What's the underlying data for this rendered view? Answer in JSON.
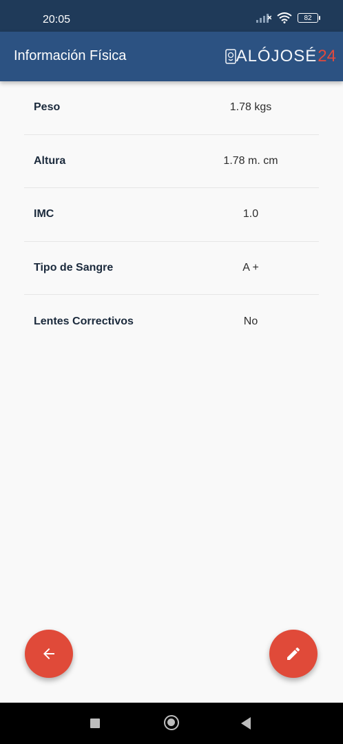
{
  "status_bar": {
    "time": "20:05",
    "battery": "82"
  },
  "app_bar": {
    "title": "Información Física",
    "logo_text": "ALÓJOSÉ",
    "logo_num": "24"
  },
  "info_rows": [
    {
      "label": "Peso",
      "value": "1.78 kgs"
    },
    {
      "label": "Altura",
      "value": "1.78 m. cm"
    },
    {
      "label": "IMC",
      "value": "1.0"
    },
    {
      "label": "Tipo de Sangre",
      "value": "A +"
    },
    {
      "label": "Lentes Correctivos",
      "value": "No"
    }
  ],
  "fabs": {
    "back_icon": "arrow-left-icon",
    "edit_icon": "pencil-icon"
  },
  "colors": {
    "status_bar": "#1f3a59",
    "app_bar": "#2c5282",
    "accent": "#e04a39",
    "background": "#f9f9f9"
  }
}
